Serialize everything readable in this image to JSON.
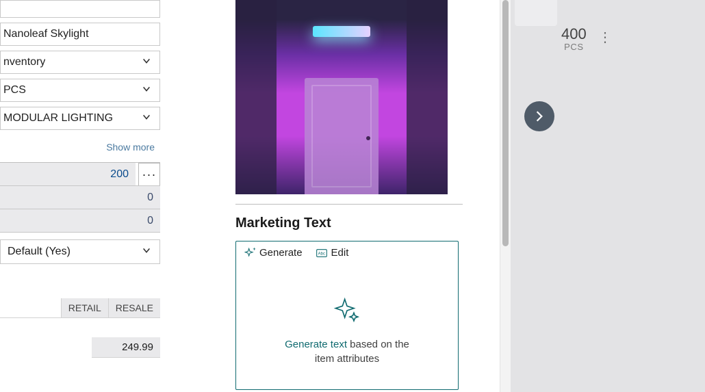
{
  "left": {
    "item_name": "Nanoleaf Skylight",
    "dropdowns": {
      "inventory": "nventory",
      "uom": "PCS",
      "category": "MODULAR LIGHTING"
    },
    "show_more": "Show more",
    "values": {
      "v1": "200",
      "v2": "0",
      "v3": "0"
    },
    "default_field": "Default (Yes)",
    "headers": {
      "retail": "RETAIL",
      "resale": "RESALE"
    },
    "price": "249.99"
  },
  "center": {
    "marketing_title": "Marketing Text",
    "generate_label": "Generate",
    "edit_label": "Edit",
    "placeholder_link": "Generate text",
    "placeholder_rest1": " based on the",
    "placeholder_rest2": "item attributes"
  },
  "right": {
    "qty": "400",
    "unit": "PCS"
  }
}
